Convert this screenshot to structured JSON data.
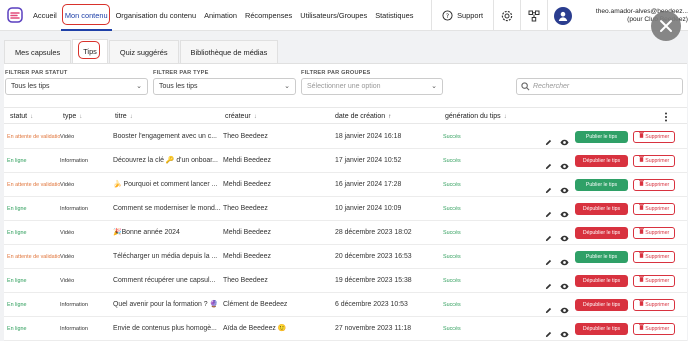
{
  "nav": {
    "items": [
      "Accueil",
      "Mon contenu",
      "Organisation du contenu",
      "Animation",
      "Récompenses",
      "Utilisateurs/Groupes",
      "Statistiques"
    ],
    "support": "Support",
    "user_email": "theo.amador-alves@beedeez...",
    "user_org": "(pour Club Beedeez)"
  },
  "tabs": [
    "Mes capsules",
    "Tips",
    "Quiz suggérés",
    "Bibliothèque de médias"
  ],
  "filters": {
    "statut_label": "FILTRER PAR STATUT",
    "statut_value": "Tous les tips",
    "type_label": "FILTRER PAR TYPE",
    "type_value": "Tous les tips",
    "groupes_label": "FILTRER PAR GROUPES",
    "groupes_placeholder": "Sélectionner une option",
    "search_placeholder": "Rechercher"
  },
  "columns": {
    "statut": "statut",
    "type": "type",
    "titre": "titre",
    "createur": "créateur",
    "date": "date de création",
    "generation": "génération du tips"
  },
  "rows": [
    {
      "statut": "En attente de validatio",
      "type": "Vidéo",
      "titre": "Booster l'engagement avec un c...",
      "createur": "Theo Beedeez",
      "date": "18 janvier 2024 16:18",
      "generation": "Succès",
      "action": "Publier le tips",
      "delete": "Supprimer"
    },
    {
      "statut": "En ligne",
      "type": "Information",
      "titre": "Découvrez la clé 🔑 d'un onboar...",
      "createur": "Mehdi Beedeez",
      "date": "17 janvier 2024 10:52",
      "generation": "Succès",
      "action": "Dépublier le tips",
      "delete": "Supprimer"
    },
    {
      "statut": "En attente de validatio",
      "type": "Vidéo",
      "titre": "🍌 Pourquoi et comment lancer ...",
      "createur": "Mehdi Beedeez",
      "date": "16 janvier 2024 17:28",
      "generation": "Succès",
      "action": "Publier le tips",
      "delete": "Supprimer"
    },
    {
      "statut": "En ligne",
      "type": "Information",
      "titre": "Comment se moderniser le mond...",
      "createur": "Theo Beedeez",
      "date": "10 janvier 2024 10:09",
      "generation": "Succès",
      "action": "Dépublier le tips",
      "delete": "Supprimer"
    },
    {
      "statut": "En ligne",
      "type": "Vidéo",
      "titre": "🎉Bonne année 2024",
      "createur": "Mehdi Beedeez",
      "date": "28 décembre 2023 18:02",
      "generation": "Succès",
      "action": "Dépublier le tips",
      "delete": "Supprimer"
    },
    {
      "statut": "En attente de validatio",
      "type": "Vidéo",
      "titre": "Télécharger un média depuis la ...",
      "createur": "Mehdi Beedeez",
      "date": "20 décembre 2023 16:53",
      "generation": "Succès",
      "action": "Publier le tips",
      "delete": "Supprimer"
    },
    {
      "statut": "En ligne",
      "type": "Vidéo",
      "titre": "Comment récupérer une capsul...",
      "createur": "Theo Beedeez",
      "date": "19 décembre 2023 15:38",
      "generation": "Succès",
      "action": "Dépublier le tips",
      "delete": "Supprimer"
    },
    {
      "statut": "En ligne",
      "type": "Information",
      "titre": "Quel avenir pour la formation ? 🔮",
      "createur": "Clément de Beedeez",
      "date": "6 décembre 2023 10:53",
      "generation": "Succès",
      "action": "Dépublier le tips",
      "delete": "Supprimer"
    },
    {
      "statut": "En ligne",
      "type": "Information",
      "titre": "Envie de contenus plus homogè...",
      "createur": "Aïda de Beedeez 🙂",
      "date": "27 novembre 2023 11:18",
      "generation": "Succès",
      "action": "Dépublier le tips",
      "delete": "Supprimer"
    }
  ],
  "colors": {
    "accent": "#1e40a8",
    "publish": "#2fa067",
    "unpublish": "#d8323f",
    "pending": "#e1763c",
    "online": "#2e9e5b"
  }
}
